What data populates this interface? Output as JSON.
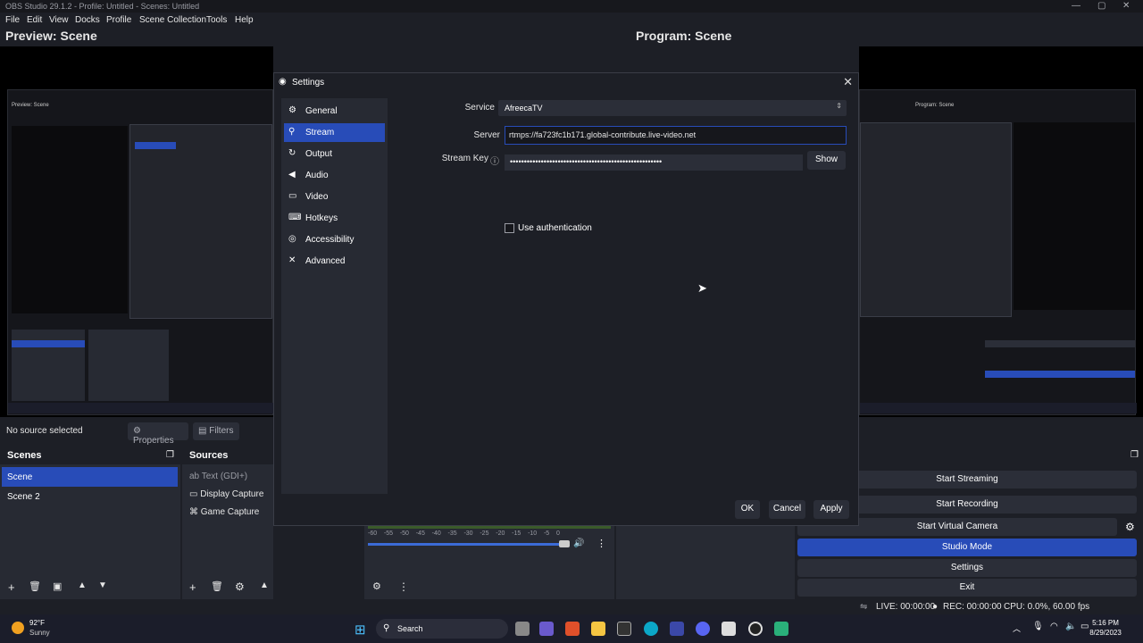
{
  "window": {
    "title": "OBS Studio 29.1.2 - Profile: Untitled - Scenes: Untitled"
  },
  "menu": [
    "File",
    "Edit",
    "View",
    "Docks",
    "Profile",
    "Scene Collection",
    "Tools",
    "Help"
  ],
  "preview": {
    "label": "Preview: Scene"
  },
  "program": {
    "label": "Program: Scene"
  },
  "source_bar": {
    "none_selected": "No source selected",
    "properties": "Properties",
    "filters": "Filters"
  },
  "scenes": {
    "title": "Scenes",
    "items": [
      "Scene",
      "Scene 2"
    ],
    "selected": 0
  },
  "sources": {
    "title": "Sources",
    "items": [
      "Text (GDI+)",
      "Display Capture",
      "Game Capture"
    ]
  },
  "mixer": {
    "ticks": [
      "-60",
      "-55",
      "-50",
      "-45",
      "-40",
      "-35",
      "-30",
      "-25",
      "-20",
      "-15",
      "-10",
      "-5",
      "0"
    ]
  },
  "controls": {
    "start_streaming": "Start Streaming",
    "start_recording": "Start Recording",
    "start_virtual_camera": "Start Virtual Camera",
    "studio_mode": "Studio Mode",
    "settings": "Settings",
    "exit": "Exit"
  },
  "status": {
    "live": "LIVE: 00:00:00",
    "rec": "REC: 00:00:00",
    "cpu": "CPU: 0.0%, 60.00 fps"
  },
  "settings_dialog": {
    "title": "Settings",
    "nav": [
      {
        "label": "General",
        "icon": "gear-icon"
      },
      {
        "label": "Stream",
        "icon": "antenna-icon"
      },
      {
        "label": "Output",
        "icon": "output-icon"
      },
      {
        "label": "Audio",
        "icon": "speaker-icon"
      },
      {
        "label": "Video",
        "icon": "monitor-icon"
      },
      {
        "label": "Hotkeys",
        "icon": "keyboard-icon"
      },
      {
        "label": "Accessibility",
        "icon": "accessibility-icon"
      },
      {
        "label": "Advanced",
        "icon": "wrench-icon"
      }
    ],
    "selected_nav": 1,
    "service_label": "Service",
    "service_value": "AfreecaTV",
    "server_label": "Server",
    "server_value": "rtmps://fa723fc1b171.global-contribute.live-video.net",
    "stream_key_label": "Stream Key",
    "stream_key_value": "••••••••••••••••••••••••••••••••••••••••••••••••••••••",
    "show_button": "Show",
    "use_auth": "Use authentication",
    "ok": "OK",
    "cancel": "Cancel",
    "apply": "Apply"
  },
  "taskbar": {
    "weather_temp": "92°F",
    "weather_desc": "Sunny",
    "search": "Search",
    "time": "5:16 PM",
    "date": "8/29/2023"
  },
  "colors": {
    "accent": "#284cb8",
    "bg": "#1d1f26",
    "panel": "#272a33"
  }
}
